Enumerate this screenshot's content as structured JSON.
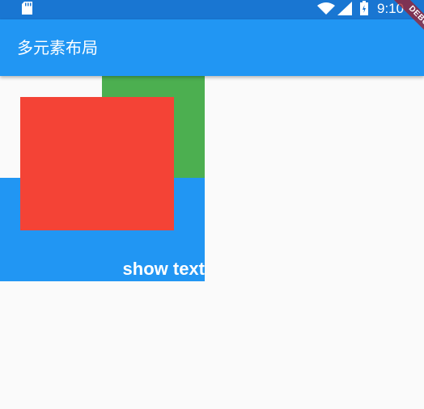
{
  "status_bar": {
    "time": "9:10",
    "icons": [
      "sd-card-icon",
      "wifi-icon",
      "signal-icon",
      "battery-icon"
    ],
    "color": "#1976d2"
  },
  "app_bar": {
    "title": "多元素布局",
    "color": "#2196f3"
  },
  "debug_banner": {
    "label": "DEBUG"
  },
  "stack": {
    "label": "show text",
    "colors": {
      "blue": "#2196f3",
      "green": "#4caf50",
      "red": "#f44336"
    }
  },
  "background_color": "#fafafa"
}
